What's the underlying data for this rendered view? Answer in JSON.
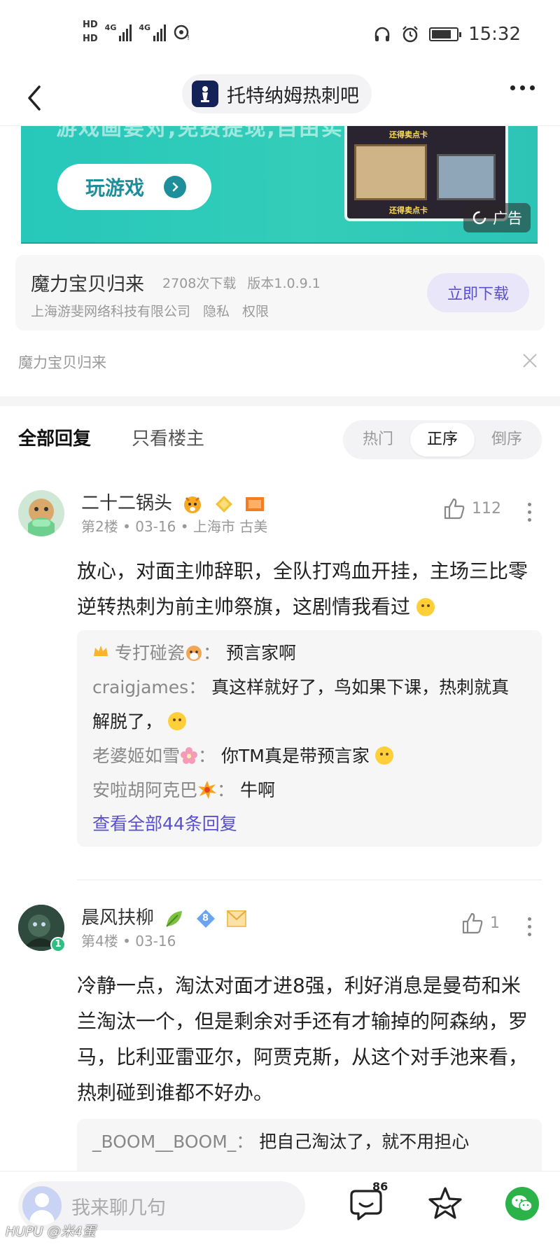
{
  "status_bar": {
    "hd1": "HD",
    "hd2": "HD",
    "net1": "4G",
    "net2": "4G",
    "time": "15:32"
  },
  "nav": {
    "forum_name": "托特纳姆热刺吧"
  },
  "ad": {
    "clipped_text": "游戏画要对,免费提现,自由实",
    "play_button": "玩游戏",
    "image_label_top": "还得卖点卡",
    "image_label_bottom": "还得卖点卡",
    "ad_tag": "广告",
    "app_name": "魔力宝贝归来",
    "downloads": "2708次下载",
    "version": "版本1.0.9.1",
    "company": "上海游斐网络科技有限公司",
    "privacy": "隐私",
    "permissions": "权限",
    "download_button": "立即下载",
    "footer_title": "魔力宝贝归来"
  },
  "tabs": {
    "all": "全部回复",
    "op_only": "只看楼主",
    "sort": [
      "热门",
      "正序",
      "倒序"
    ],
    "active_sort": "正序"
  },
  "posts": [
    {
      "user": "二十二锅头",
      "meta": "第2楼 • 03-16 • 上海市 古美",
      "likes": "112",
      "body": "放心，对面主帅辞职，全队打鸡血开挂，主场三比零逆转热刺为前主帅祭旗，这剧情我看过",
      "replies": [
        {
          "name": "专打碰瓷",
          "text": "预言家啊"
        },
        {
          "name": "craigjames",
          "text": "真这样就好了，鸟如果下课，热刺就真解脱了，"
        },
        {
          "name": "老婆姬如雪",
          "text": "你TM真是带预言家"
        },
        {
          "name": "安啦胡阿克巴",
          "text": "牛啊"
        }
      ],
      "view_all": "查看全部44条回复"
    },
    {
      "user": "晨风扶柳",
      "level": "8",
      "avatar_badge": "1",
      "meta": "第4楼 • 03-16",
      "likes": "1",
      "body": "冷静一点，淘汰对面才进8强，利好消息是曼苟和米兰淘汰一个，但是剩余对手还有才输掉的阿森纳，罗马，比利亚雷亚尔，阿贾克斯，从这个对手池来看，热刺碰到谁都不好办。",
      "replies": [
        {
          "name": "_BOOM__BOOM_",
          "text": "把自己淘汰了，就不用担心"
        }
      ]
    }
  ],
  "bottom_bar": {
    "placeholder": "我来聊几句",
    "comment_count": "86"
  },
  "watermark": "HUPU @米4蛋",
  "colors": {
    "accent": "#5a4fcf",
    "ad_green": "#2dc4b6",
    "wechat": "#2bb34a"
  }
}
